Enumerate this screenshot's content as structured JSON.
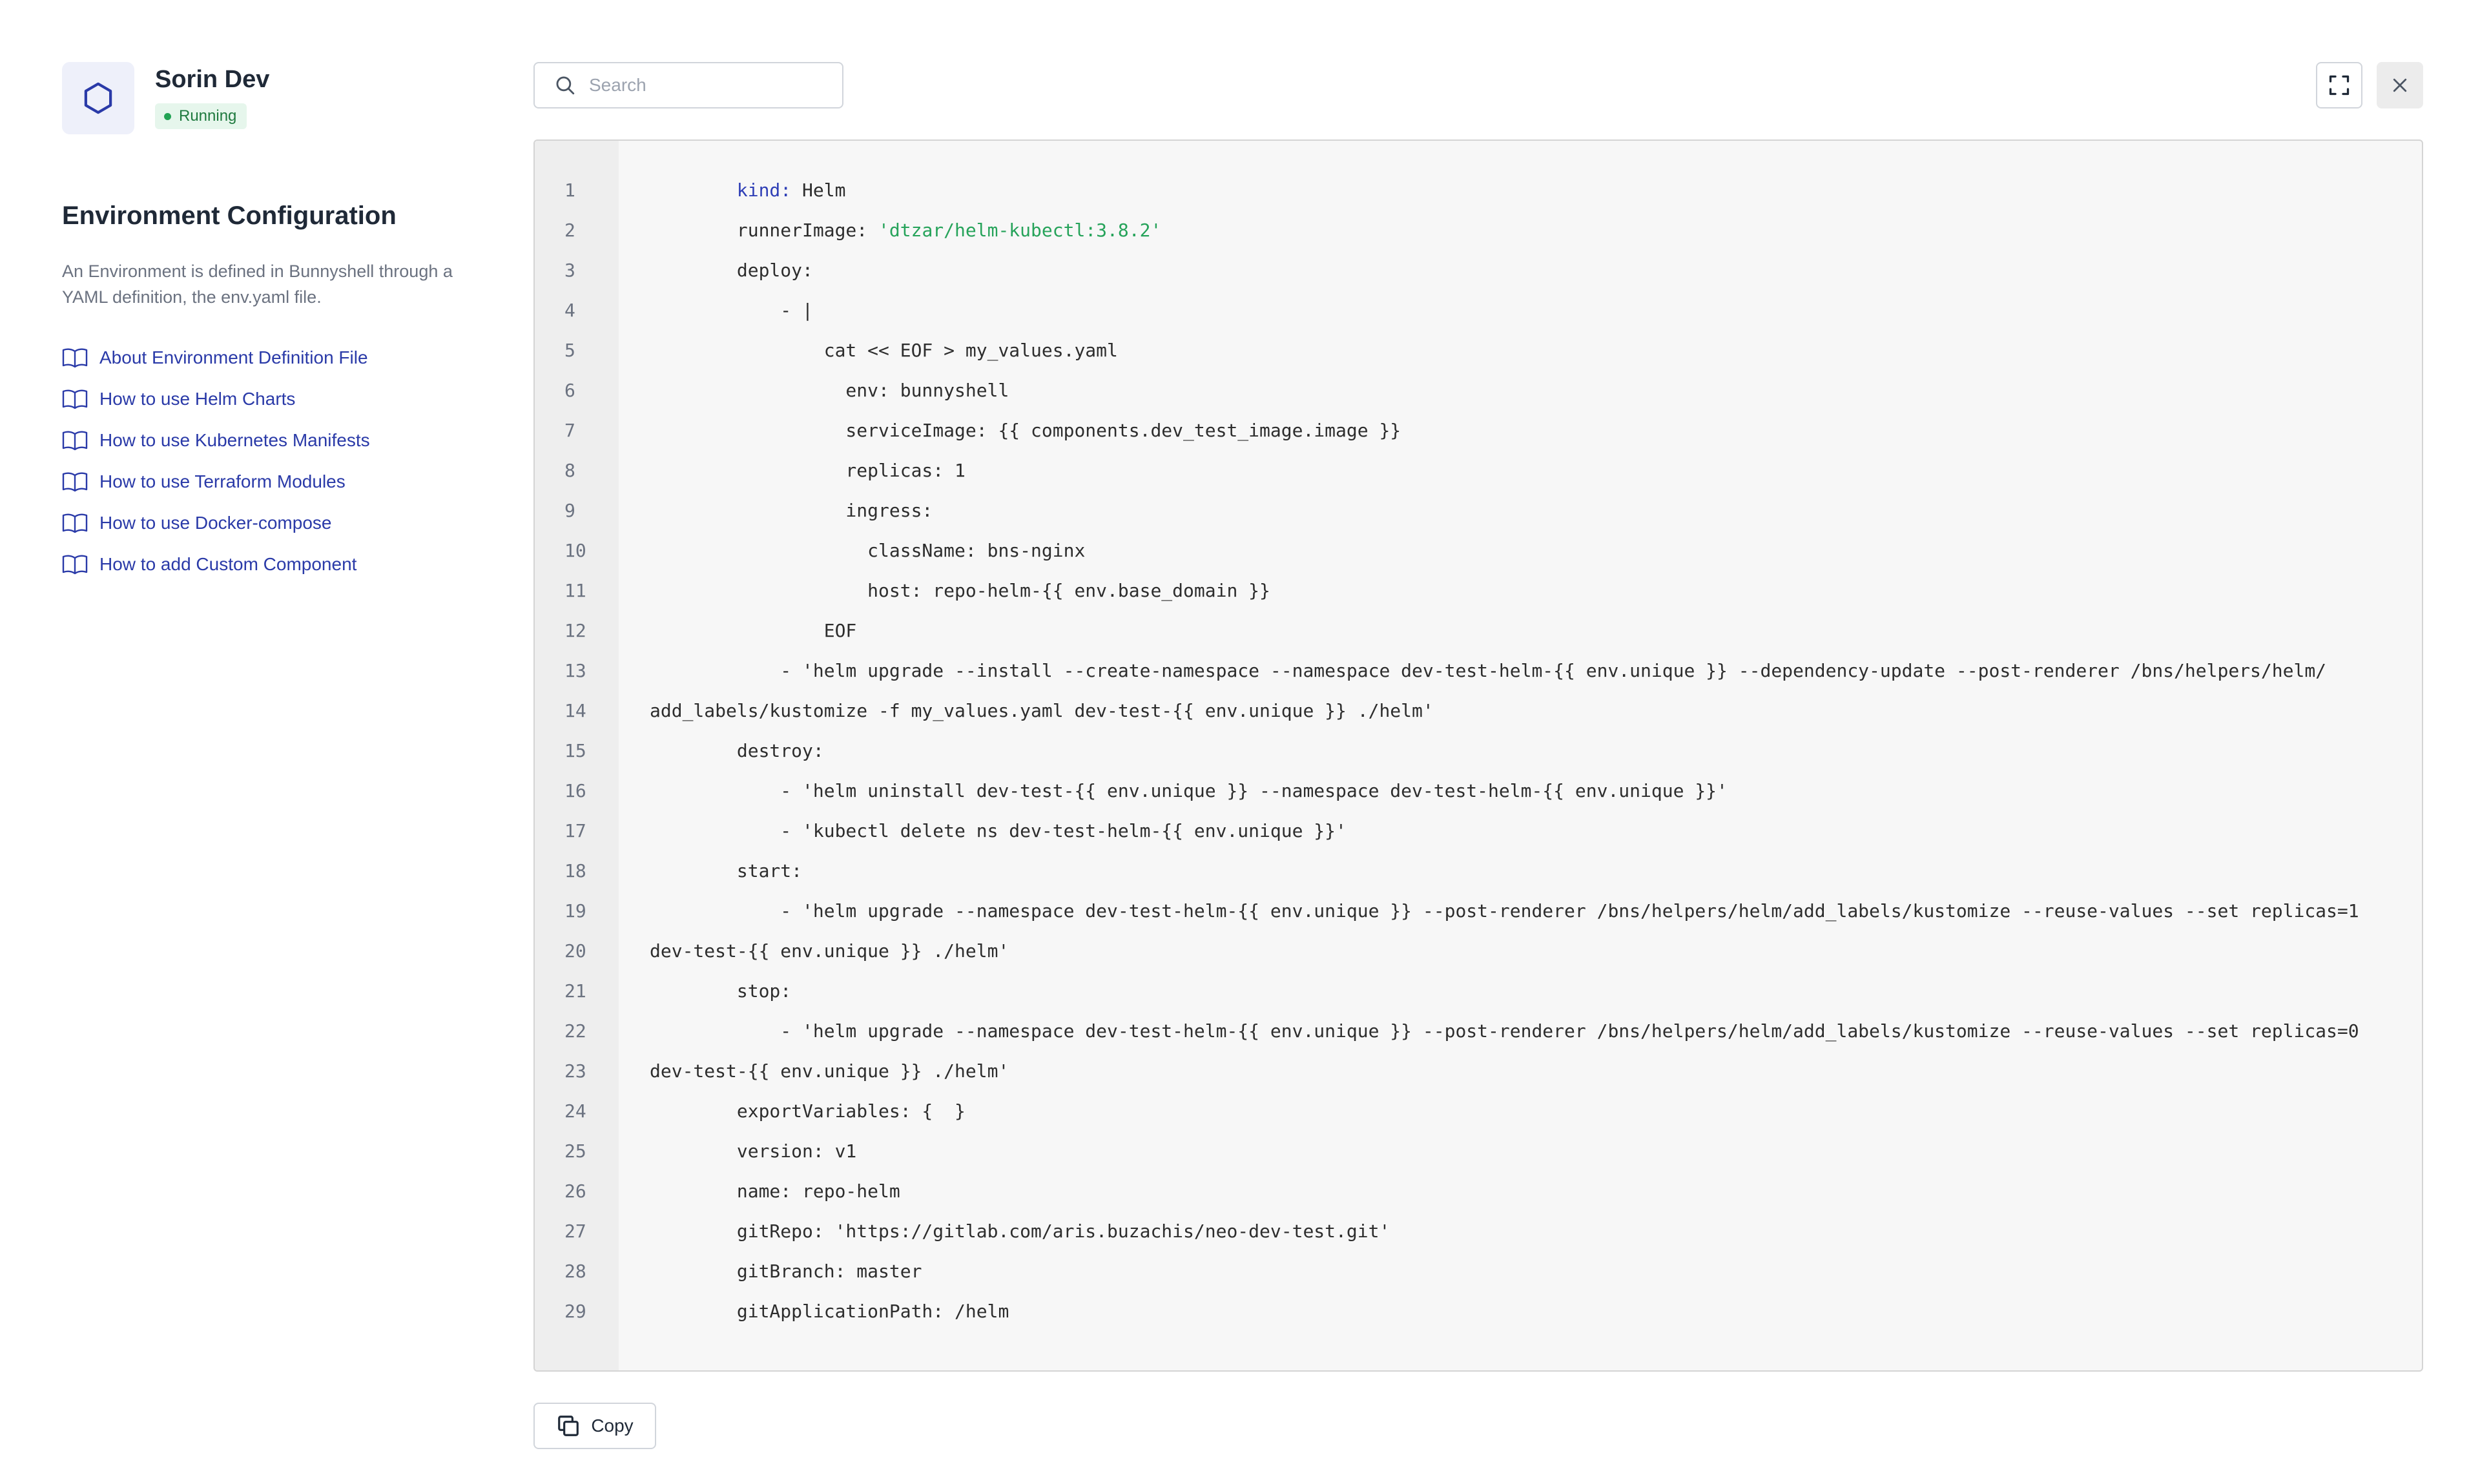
{
  "environment": {
    "name": "Sorin Dev",
    "status": "Running",
    "icon": "hexagon-icon"
  },
  "sidebar": {
    "title": "Environment Configuration",
    "description": "An Environment is defined in Bunnyshell through a YAML definition, the env.yaml file.",
    "links": [
      {
        "label": "About Environment Definition File",
        "icon": "book-icon"
      },
      {
        "label": "How to use Helm Charts",
        "icon": "book-icon"
      },
      {
        "label": "How to use Kubernetes Manifests",
        "icon": "book-icon"
      },
      {
        "label": "How to use Terraform Modules",
        "icon": "book-icon"
      },
      {
        "label": "How to use Docker-compose",
        "icon": "book-icon"
      },
      {
        "label": "How to add Custom Component",
        "icon": "book-icon"
      }
    ]
  },
  "search": {
    "placeholder": "Search",
    "value": ""
  },
  "toolbar": {
    "fullscreen_icon": "expand-icon",
    "close_icon": "close-icon"
  },
  "colors": {
    "accent": "#2a3aa8",
    "status_green": "#22a354",
    "yaml_key": "#2f3fb6",
    "yaml_string": "#26a35a"
  },
  "editor": {
    "lines": [
      {
        "n": "1",
        "parts": [
          {
            "t": "        "
          },
          {
            "t": "kind:",
            "c": "key"
          },
          {
            "t": " Helm"
          }
        ]
      },
      {
        "n": "2",
        "parts": [
          {
            "t": "        runnerImage: "
          },
          {
            "t": "'dtzar/helm-kubectl:3.8.2'",
            "c": "str"
          }
        ]
      },
      {
        "n": "3",
        "parts": [
          {
            "t": "        deploy:"
          }
        ]
      },
      {
        "n": "4",
        "parts": [
          {
            "t": "            - |"
          }
        ]
      },
      {
        "n": "5",
        "parts": [
          {
            "t": "                cat << EOF > my_values.yaml"
          }
        ]
      },
      {
        "n": "6",
        "parts": [
          {
            "t": "                  env: bunnyshell"
          }
        ]
      },
      {
        "n": "7",
        "parts": [
          {
            "t": "                  serviceImage: {{ components.dev_test_image.image }}"
          }
        ]
      },
      {
        "n": "8",
        "parts": [
          {
            "t": "                  replicas: 1"
          }
        ]
      },
      {
        "n": "9",
        "parts": [
          {
            "t": "                  ingress:"
          }
        ]
      },
      {
        "n": "10",
        "parts": [
          {
            "t": "                    className: bns-nginx"
          }
        ]
      },
      {
        "n": "11",
        "parts": [
          {
            "t": "                    host: repo-helm-{{ env.base_domain }}"
          }
        ]
      },
      {
        "n": "12",
        "parts": [
          {
            "t": "                EOF"
          }
        ]
      },
      {
        "n": "13",
        "parts": [
          {
            "t": "            - 'helm upgrade --install --create-namespace --namespace dev-test-helm-{{ env.unique }} --dependency-update --post-renderer /bns/helpers/helm/"
          }
        ]
      },
      {
        "n": "14",
        "parts": [
          {
            "t": "add_labels/kustomize -f my_values.yaml dev-test-{{ env.unique }} ./helm'"
          }
        ]
      },
      {
        "n": "15",
        "parts": [
          {
            "t": "        destroy:"
          }
        ]
      },
      {
        "n": "16",
        "parts": [
          {
            "t": "            - 'helm uninstall dev-test-{{ env.unique }} --namespace dev-test-helm-{{ env.unique }}'"
          }
        ]
      },
      {
        "n": "17",
        "parts": [
          {
            "t": "            - 'kubectl delete ns dev-test-helm-{{ env.unique }}'"
          }
        ]
      },
      {
        "n": "18",
        "parts": [
          {
            "t": "        start:"
          }
        ]
      },
      {
        "n": "19",
        "parts": [
          {
            "t": "            - 'helm upgrade --namespace dev-test-helm-{{ env.unique }} --post-renderer /bns/helpers/helm/add_labels/kustomize --reuse-values --set replicas=1"
          }
        ]
      },
      {
        "n": "20",
        "parts": [
          {
            "t": "dev-test-{{ env.unique }} ./helm'"
          }
        ]
      },
      {
        "n": "21",
        "parts": [
          {
            "t": "        stop:"
          }
        ]
      },
      {
        "n": "22",
        "parts": [
          {
            "t": "            - 'helm upgrade --namespace dev-test-helm-{{ env.unique }} --post-renderer /bns/helpers/helm/add_labels/kustomize --reuse-values --set replicas=0"
          }
        ]
      },
      {
        "n": "23",
        "parts": [
          {
            "t": "dev-test-{{ env.unique }} ./helm'"
          }
        ]
      },
      {
        "n": "24",
        "parts": [
          {
            "t": "        exportVariables: {  }"
          }
        ]
      },
      {
        "n": "25",
        "parts": [
          {
            "t": "        version: v1"
          }
        ]
      },
      {
        "n": "26",
        "parts": [
          {
            "t": "        name: repo-helm"
          }
        ]
      },
      {
        "n": "27",
        "parts": [
          {
            "t": "        gitRepo: 'https://gitlab.com/aris.buzachis/neo-dev-test.git'"
          }
        ]
      },
      {
        "n": "28",
        "parts": [
          {
            "t": "        gitBranch: master"
          }
        ]
      },
      {
        "n": "29",
        "parts": [
          {
            "t": "        gitApplicationPath: /helm"
          }
        ]
      }
    ]
  },
  "copy_button": {
    "label": "Copy",
    "icon": "copy-icon"
  }
}
